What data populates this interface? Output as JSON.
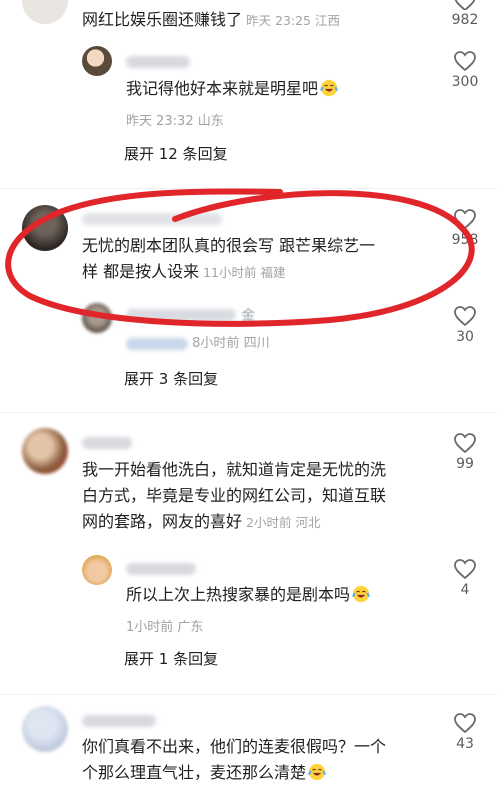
{
  "comments": [
    {
      "text_tail": "网红比娱乐圈还赚钱了",
      "time": "昨天 23:25",
      "location": "江西",
      "likes": "982",
      "reply": {
        "text": "我记得他好本来就是明星吧",
        "time": "昨天 23:32",
        "location": "山东",
        "likes": "300"
      },
      "expand_label": "展开 12 条回复"
    },
    {
      "text_line1": "无忧的剧本团队真的很会写 跟芒果综艺一",
      "text_line2": "样 都是按人设来",
      "time": "11小时前",
      "location": "福建",
      "likes": "958",
      "reply": {
        "name_fragment": "金",
        "time": "8小时前",
        "location": "四川",
        "likes": "30"
      },
      "expand_label": "展开 3 条回复"
    },
    {
      "text_line1": "我一开始看他洗白，就知道肯定是无忧的洗",
      "text_line2": "白方式，毕竟是专业的网红公司，知道互联",
      "text_line3": "网的套路，网友的喜好",
      "time": "2小时前",
      "location": "河北",
      "likes": "99",
      "reply": {
        "text": "所以上次上热搜家暴的是剧本吗",
        "time": "1小时前",
        "location": "广东",
        "likes": "4"
      },
      "expand_label": "展开 1 条回复"
    },
    {
      "text_line1": "你们真看不出来，他们的连麦很假吗？一个",
      "text_line2": "个那么理直气壮，麦还那么清楚",
      "likes": "43"
    }
  ],
  "colors": {
    "annotation_circle": "#e0262b",
    "meta_text": "#a3a3a3",
    "body_text": "#202020"
  },
  "icons": {
    "like": "heart-outline-icon",
    "emoji": "crying-laughing-emoji-icon"
  }
}
